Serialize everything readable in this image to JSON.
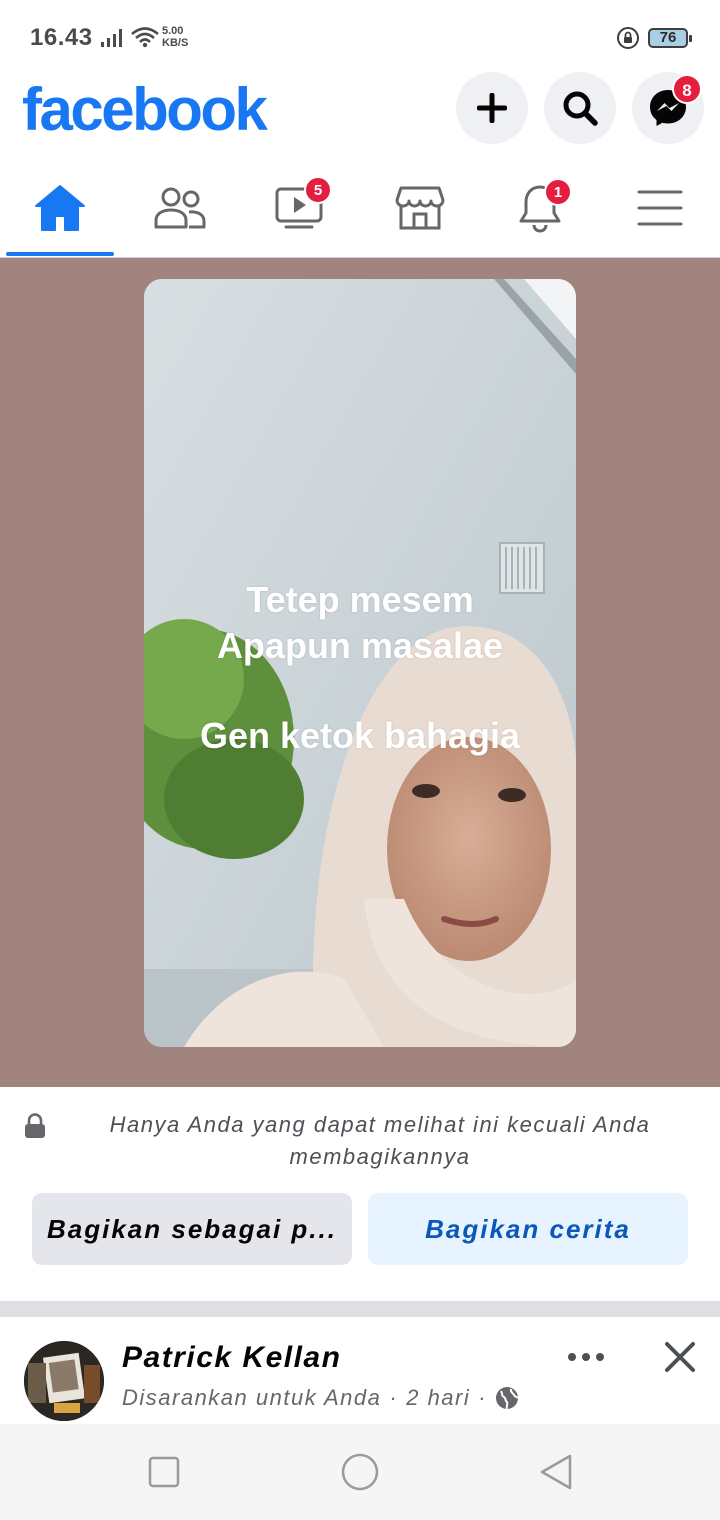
{
  "status_bar": {
    "time": "16.43",
    "speed_value": "5.00",
    "speed_unit": "KB/S",
    "battery": "76"
  },
  "header": {
    "logo": "facebook",
    "messenger_badge": "8",
    "brand_color": "#1877f2"
  },
  "tabs": [
    {
      "name": "home",
      "icon": "home-icon",
      "active": true
    },
    {
      "name": "friends",
      "icon": "friends-icon"
    },
    {
      "name": "video",
      "icon": "video-icon",
      "badge": "5"
    },
    {
      "name": "marketplace",
      "icon": "marketplace-icon"
    },
    {
      "name": "notifications",
      "icon": "bell-icon",
      "badge": "1"
    },
    {
      "name": "menu",
      "icon": "menu-icon"
    }
  ],
  "story": {
    "line1": "Tetep mesem",
    "line2": "Apapun masalae",
    "line3": "Gen ketok bahagia",
    "background_color": "#a0847d"
  },
  "privacy": {
    "notice": "Hanya Anda yang dapat melihat ini kecuali Anda membagikannya"
  },
  "actions": {
    "share_as": "Bagikan sebagai p...",
    "share_story": "Bagikan cerita"
  },
  "post": {
    "author": "Patrick Kellan",
    "suggested": "Disarankan untuk Anda",
    "separator": "·",
    "time": "2 hari"
  }
}
